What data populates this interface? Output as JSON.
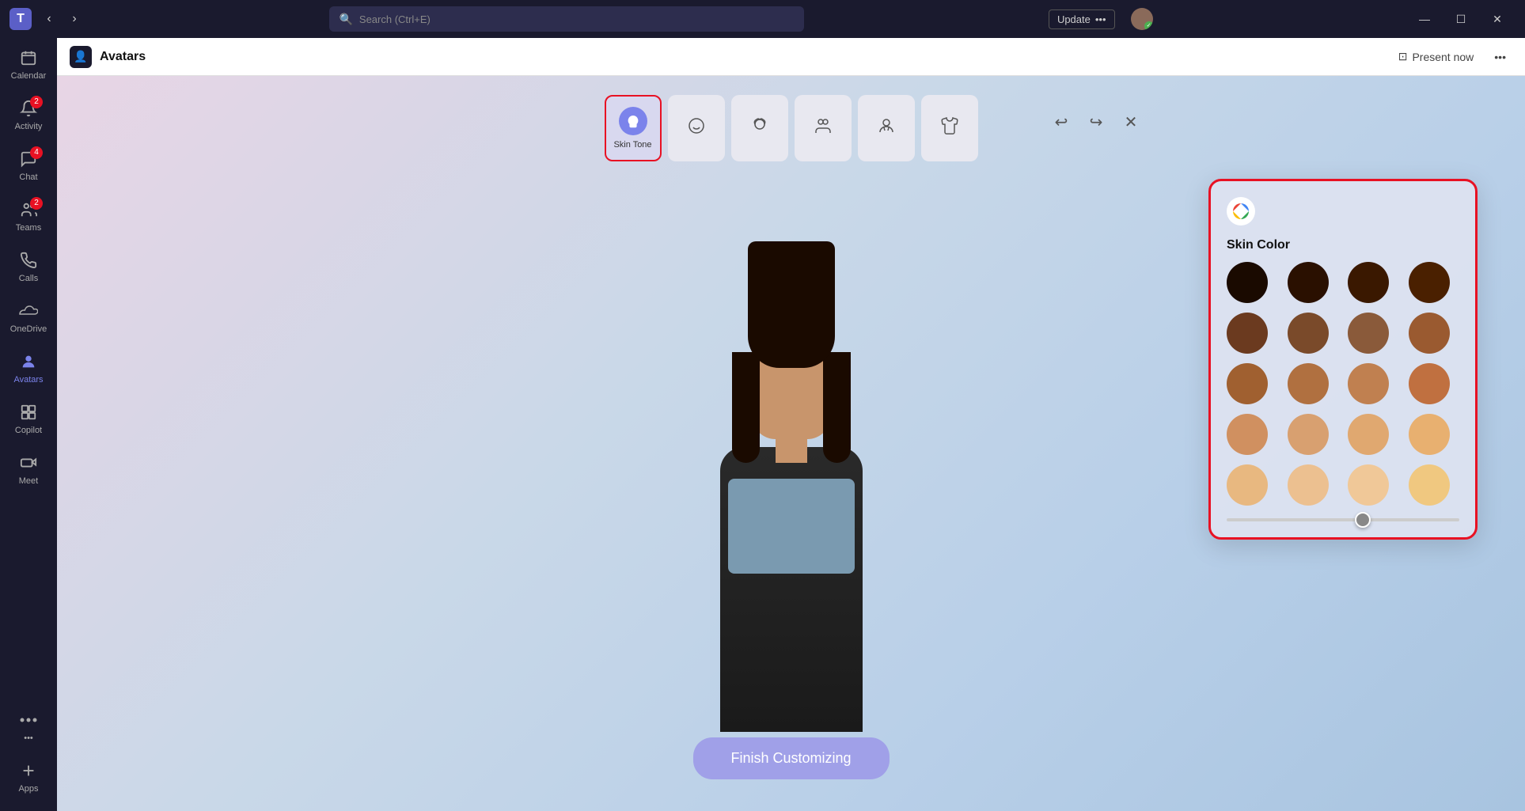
{
  "titlebar": {
    "search_placeholder": "Search (Ctrl+E)",
    "update_label": "Update",
    "update_more": "•••",
    "minimize_label": "—",
    "maximize_label": "☐",
    "close_label": "✕",
    "back_label": "‹",
    "forward_label": "›"
  },
  "sidebar": {
    "items": [
      {
        "id": "calendar",
        "label": "Calendar",
        "icon": "📅",
        "badge": null
      },
      {
        "id": "activity",
        "label": "Activity",
        "icon": "🔔",
        "badge": "2"
      },
      {
        "id": "chat",
        "label": "Chat",
        "icon": "💬",
        "badge": "4"
      },
      {
        "id": "teams",
        "label": "Teams",
        "icon": "👥",
        "badge": "2"
      },
      {
        "id": "calls",
        "label": "Calls",
        "icon": "📞",
        "badge": null
      },
      {
        "id": "onedrive",
        "label": "OneDrive",
        "icon": "☁",
        "badge": null
      },
      {
        "id": "avatars",
        "label": "Avatars",
        "icon": "👤",
        "badge": null,
        "active": true
      },
      {
        "id": "copilot",
        "label": "Copilot",
        "icon": "⊞",
        "badge": null
      },
      {
        "id": "meet",
        "label": "Meet",
        "icon": "🎥",
        "badge": null
      },
      {
        "id": "more",
        "label": "•••",
        "icon": "•••",
        "badge": null
      },
      {
        "id": "apps",
        "label": "Apps",
        "icon": "＋",
        "badge": null
      }
    ]
  },
  "header": {
    "app_icon": "👤",
    "title": "Avatars",
    "present_now_label": "Present now",
    "more_label": "•••"
  },
  "categories": [
    {
      "id": "skin-tone",
      "label": "Skin Tone",
      "icon": "🎨",
      "active": true
    },
    {
      "id": "face",
      "label": "",
      "icon": "😊",
      "active": false
    },
    {
      "id": "hair",
      "label": "",
      "icon": "💆",
      "active": false
    },
    {
      "id": "body",
      "label": "",
      "icon": "👥",
      "active": false
    },
    {
      "id": "accessories",
      "label": "",
      "icon": "🤷",
      "active": false
    },
    {
      "id": "clothing",
      "label": "",
      "icon": "👕",
      "active": false
    }
  ],
  "toolbar_actions": {
    "undo_label": "↩",
    "redo_label": "↪",
    "close_label": "✕"
  },
  "finish_button": {
    "label": "Finish Customizing"
  },
  "skin_panel": {
    "logo": "🎨",
    "title": "Skin Color",
    "selected_color": "#e8cba0",
    "colors": [
      "#1a0a00",
      "#2a1000",
      "#3a1800",
      "#4a2000",
      "#6b3a1f",
      "#7a4a2a",
      "#8a5a3a",
      "#9a5a30",
      "#a06030",
      "#b07040",
      "#c08050",
      "#c07040",
      "#d09060",
      "#d8a070",
      "#e0a870",
      "#e8b070",
      "#e8b880",
      "#ecc090",
      "#f0c898",
      "#f0c880"
    ],
    "slider_value": 55
  }
}
